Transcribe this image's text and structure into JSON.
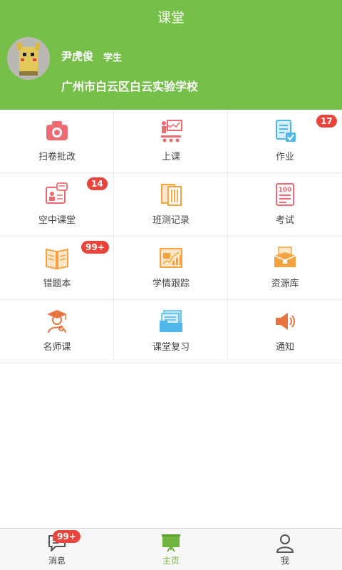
{
  "header": {
    "title": "课堂",
    "user_name": "尹虎俊",
    "user_role": "学生",
    "school": "广州市白云区白云实验学校"
  },
  "grid": [
    {
      "label": "扫卷批改",
      "icon": "camera-icon"
    },
    {
      "label": "上课",
      "icon": "teacher-board-icon"
    },
    {
      "label": "作业",
      "icon": "homework-doc-icon",
      "badge": "17"
    },
    {
      "label": "空中课堂",
      "icon": "online-class-icon",
      "badge": "14"
    },
    {
      "label": "班测记录",
      "icon": "test-record-icon"
    },
    {
      "label": "考试",
      "icon": "exam-icon"
    },
    {
      "label": "错题本",
      "icon": "book-icon",
      "badge": "99+"
    },
    {
      "label": "学情跟踪",
      "icon": "analytics-chart-icon"
    },
    {
      "label": "资源库",
      "icon": "resource-box-icon"
    },
    {
      "label": "名师课",
      "icon": "graduate-teacher-icon"
    },
    {
      "label": "课堂复习",
      "icon": "review-stack-icon"
    },
    {
      "label": "通知",
      "icon": "speaker-icon"
    }
  ],
  "tabbar": {
    "tabs": [
      {
        "label": "消息",
        "icon": "message-icon",
        "badge": "99+"
      },
      {
        "label": "主页",
        "icon": "home-board-icon",
        "active": true
      },
      {
        "label": "我",
        "icon": "person-icon"
      }
    ]
  },
  "colors": {
    "brand_green": "#76c04a",
    "badge_red": "#e8453c",
    "icon_pink": "#ef6b73",
    "icon_orange": "#f5a340",
    "icon_blue": "#4fb7e8"
  }
}
